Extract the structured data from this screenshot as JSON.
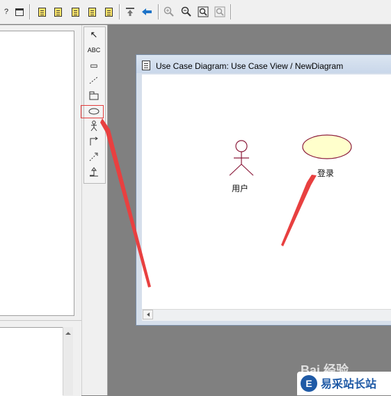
{
  "toolbar": {
    "left_cut_glyph": "?",
    "zoom_in_icon": "zoom-in-icon",
    "zoom_out_icon": "zoom-out-icon"
  },
  "palette": {
    "tools": [
      {
        "name": "select-tool",
        "glyph": "↖"
      },
      {
        "name": "text-tool",
        "glyph": "ABC"
      },
      {
        "name": "note-tool",
        "glyph": "▭"
      },
      {
        "name": "anchor-tool",
        "glyph": "╱"
      },
      {
        "name": "package-tool",
        "glyph": "🗀"
      },
      {
        "name": "usecase-tool",
        "glyph": "⬭"
      },
      {
        "name": "actor-tool",
        "glyph": "웃"
      },
      {
        "name": "association-tool",
        "glyph": "↱"
      },
      {
        "name": "dependency-tool",
        "glyph": "↗"
      },
      {
        "name": "generalization-tool",
        "glyph": "↥"
      }
    ]
  },
  "window": {
    "title": "Use Case Diagram: Use Case View / NewDiagram"
  },
  "diagram": {
    "actor": {
      "label": "用户"
    },
    "usecase": {
      "label": "登录",
      "fill": "#ffffcc",
      "stroke": "#8b1a3a"
    }
  },
  "annotation": {
    "arrow_color": "#e84040"
  },
  "watermark": {
    "baidu": "Bai 经验",
    "brand": "易采站长站",
    "brand_mark": "E"
  }
}
